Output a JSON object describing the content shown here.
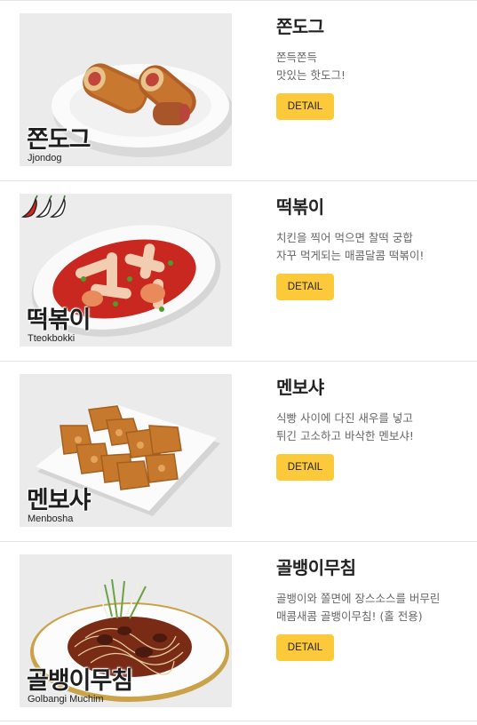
{
  "items": [
    {
      "title": "쫀도그",
      "desc_line1": "쫀득쫀득",
      "desc_line2": "맛있는 핫도그!",
      "photo_title": "쫀도그",
      "photo_subtitle": "Jjondog",
      "button": "DETAIL",
      "icon": "hotdog-photo"
    },
    {
      "title": "떡볶이",
      "desc_line1": "치킨을 찍어 먹으면 찰떡 궁합",
      "desc_line2": "자꾸 먹게되는 매콤달콤 떡볶이!",
      "photo_title": "떡볶이",
      "photo_subtitle": "Tteokbokki",
      "button": "DETAIL",
      "icon": "tteokbokki-photo",
      "spicy_level": 3
    },
    {
      "title": "멘보샤",
      "desc_line1": "식빵 사이에 다진 새우를 넣고",
      "desc_line2": "튀긴 고소하고 바삭한 멘보샤!",
      "photo_title": "멘보샤",
      "photo_subtitle": "Menbosha",
      "button": "DETAIL",
      "icon": "menbosha-photo"
    },
    {
      "title": "골뱅이무침",
      "desc_line1": "골뱅이와 쫄면에 장스소스를 버무린",
      "desc_line2": "매콤새콤 골뱅이무침! (홀 전용)",
      "photo_title": "골뱅이무침",
      "photo_subtitle": "Golbangi Muchim",
      "button": "DETAIL",
      "icon": "golbangi-photo"
    }
  ]
}
